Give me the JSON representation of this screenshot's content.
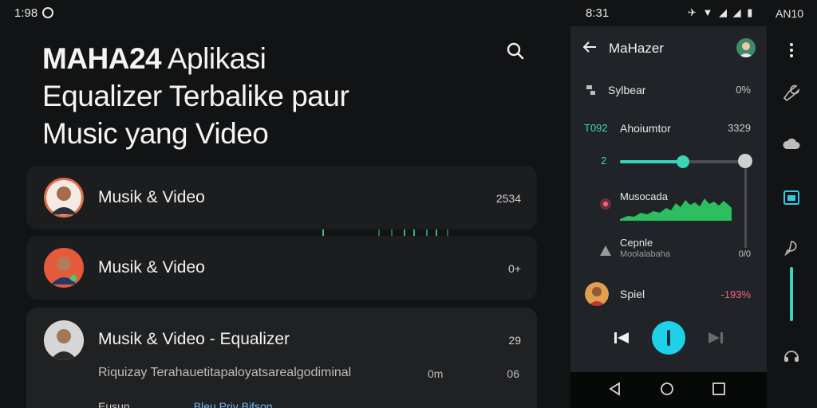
{
  "status_bar": {
    "time_left": "1:98",
    "time_right": "8:31",
    "icons": "✈ ▼ ◢ ◢ ▮",
    "label": "AN10"
  },
  "headline": {
    "strong": "MAHA24",
    "rest_line1": " Aplikasi",
    "line2": "Equalizer Terbalike paur",
    "line3": "Music yang Video"
  },
  "cards": [
    {
      "title": "Musik & Video",
      "value": "2534"
    },
    {
      "title": "Musik & Video",
      "value": "0+"
    },
    {
      "title": "Musik & Video - Equalizer",
      "value": "29",
      "subtitle": "Riquizay Terahauetitapaloyatsarealgodiminal",
      "subtitle_value": "0m",
      "subtitle_value2": "06",
      "footer": "Eusun",
      "footer_link": "Bleu Priv  Bifson"
    }
  ],
  "panel": {
    "title": "MaHazer",
    "row1": {
      "label": "Sylbear",
      "value": "0%"
    },
    "row2": {
      "prefix": "T092",
      "label": "Ahoiumtor",
      "value": "3329"
    },
    "slider": {
      "label": "2",
      "value": 0.5
    },
    "row3": {
      "label": "Musocada"
    },
    "row4": {
      "label": "Cepnle",
      "sub": "Moolalabaha",
      "value": "0/0"
    },
    "row5": {
      "label": "Spiel",
      "value": "-193%"
    }
  },
  "colors": {
    "accent": "#37d6b8",
    "play": "#1fd1e8",
    "value_red": "#f06a7a"
  },
  "icons": {
    "search": "search-icon",
    "back": "arrow-left-icon",
    "menu": "more-vertical-icon"
  }
}
